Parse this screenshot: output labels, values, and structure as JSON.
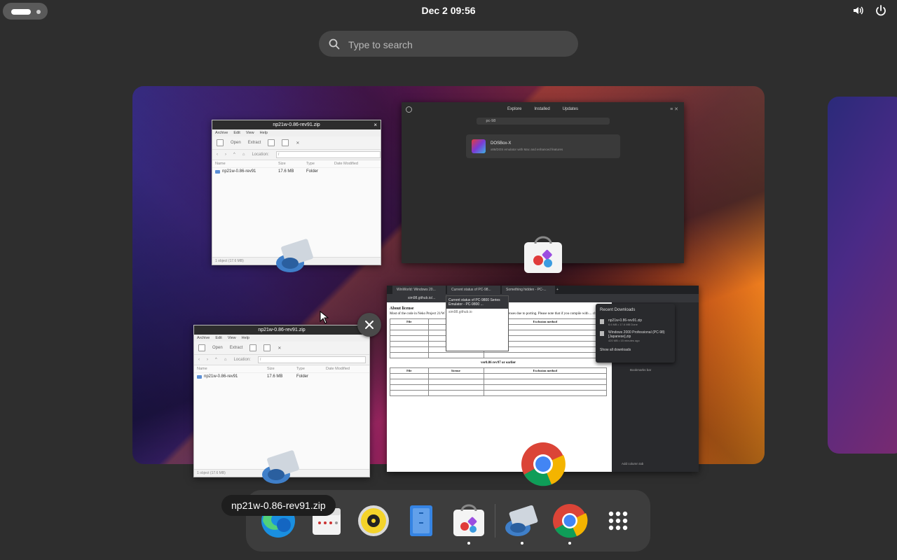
{
  "topbar": {
    "clock": "Dec 2  09:56"
  },
  "search": {
    "placeholder": "Type to search"
  },
  "windows": {
    "fileroller_top": {
      "title": "np21w-0.86-rev91.zip",
      "menu": [
        "Archive",
        "Edit",
        "View",
        "Help"
      ],
      "open_label": "Open",
      "extract_label": "Extract",
      "location_label": "Location:",
      "location_value": "/",
      "columns": [
        "Name",
        "Size",
        "Type",
        "Date Modified"
      ],
      "rows": [
        {
          "name": "np21w-0.86-rev91",
          "size": "17.6 MB",
          "type": "Folder"
        }
      ],
      "status": "1 object (17.6 MB)"
    },
    "fileroller_bottom": {
      "title": "np21w-0.86-rev91.zip",
      "menu": [
        "Archive",
        "Edit",
        "View",
        "Help"
      ],
      "open_label": "Open",
      "extract_label": "Extract",
      "location_label": "Location:",
      "location_value": "/",
      "columns": [
        "Name",
        "Size",
        "Type",
        "Date Modified"
      ],
      "rows": [
        {
          "name": "np21w-0.86-rev91",
          "size": "17.6 MB",
          "type": "Folder"
        }
      ],
      "status": "1 object (17.6 MB)"
    },
    "software": {
      "tabs": [
        "Explore",
        "Installed",
        "Updates"
      ],
      "search_value": "pc-98",
      "result_name": "DOSBox-X",
      "result_desc": "x86/DOS emulator with Mac and enhanced features"
    },
    "chrome": {
      "tabs": [
        "WinWorld: Windows 20...",
        "Current status of PC-98...",
        "Something hidden - PC-..."
      ],
      "address": "sim98.github.io/...",
      "tab_preview_title": "Current status of PC-9800 Series Emulator - PC-9800 ...",
      "tab_preview_host": "sim98.github.io",
      "page_heading": "About license",
      "page_text": "Most of the code in Neko Project 21/W is under the following files have different licenses due to porting. Please note that if you compile with ... change",
      "table_headers": [
        "File",
        "license",
        "Exclusion method"
      ],
      "section2": "ver0.86 rev97 or earlier",
      "downloads_title": "Recent Downloads",
      "downloads": [
        {
          "name": "np21w-0.86-rev91.zip",
          "sub": "6.6 MB • 17.6 MB Done"
        },
        {
          "name": "Windows 2000 Professional (PC-98) [Japanese].zip",
          "sub": "420 MB • 15 minutes ago"
        }
      ],
      "downloads_show_all": "Show all downloads",
      "bookmarks": "Bookmarks bar",
      "add_column": "Add column tab"
    }
  },
  "tooltip": "np21w-0.86-rev91.zip",
  "dock": {
    "items": [
      {
        "name": "edge-browser",
        "running": false
      },
      {
        "name": "calendar",
        "running": false
      },
      {
        "name": "rhythmbox",
        "running": false
      },
      {
        "name": "file-manager",
        "running": false
      },
      {
        "name": "software-store",
        "running": true
      },
      {
        "name": "archive-manager",
        "running": true
      },
      {
        "name": "chrome",
        "running": true
      },
      {
        "name": "show-apps",
        "running": false
      }
    ]
  },
  "colors": {
    "panel": "#2e2e2e",
    "dock": "#3d3d3d",
    "accent_blue": "#3584e4"
  }
}
